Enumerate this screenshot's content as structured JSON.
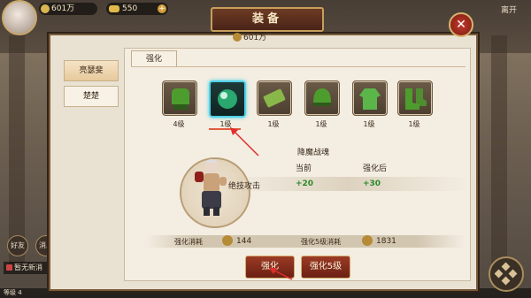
{
  "hud": {
    "money": "601万",
    "gold": "550",
    "gold_plus": "+",
    "leave": "离开",
    "side_buttons": [
      "好友",
      "消息"
    ],
    "news": "暂无新消",
    "level_text": "等级 4"
  },
  "panel": {
    "title": "装备",
    "close": "✕",
    "money": "601万",
    "tab": "强化"
  },
  "characters": [
    "亮瑟斐",
    "楚楚"
  ],
  "equipment": [
    {
      "icon": "gauntlet-icon",
      "level": "4级",
      "color": "#4d9d2e"
    },
    {
      "icon": "orb-icon",
      "level": "1级",
      "color": "#2aa86f",
      "selected": true
    },
    {
      "icon": "scroll-icon",
      "level": "1级",
      "color": "#8ab74a"
    },
    {
      "icon": "helmet-icon",
      "level": "1级",
      "color": "#4d9d2e"
    },
    {
      "icon": "robe-icon",
      "level": "1级",
      "color": "#5bb64a"
    },
    {
      "icon": "boots-icon",
      "level": "1级",
      "color": "#4d9d2e"
    }
  ],
  "stats": {
    "title": "降魔战魂",
    "col_current": "当前",
    "col_after": "强化后",
    "label": "绝技攻击",
    "current": "+20",
    "after": "+30"
  },
  "costs": {
    "single_label": "强化消耗",
    "single_value": "144",
    "five_label": "强化5级消耗",
    "five_value": "1831"
  },
  "buttons": {
    "strengthen": "强化",
    "strengthen5": "强化5级"
  }
}
